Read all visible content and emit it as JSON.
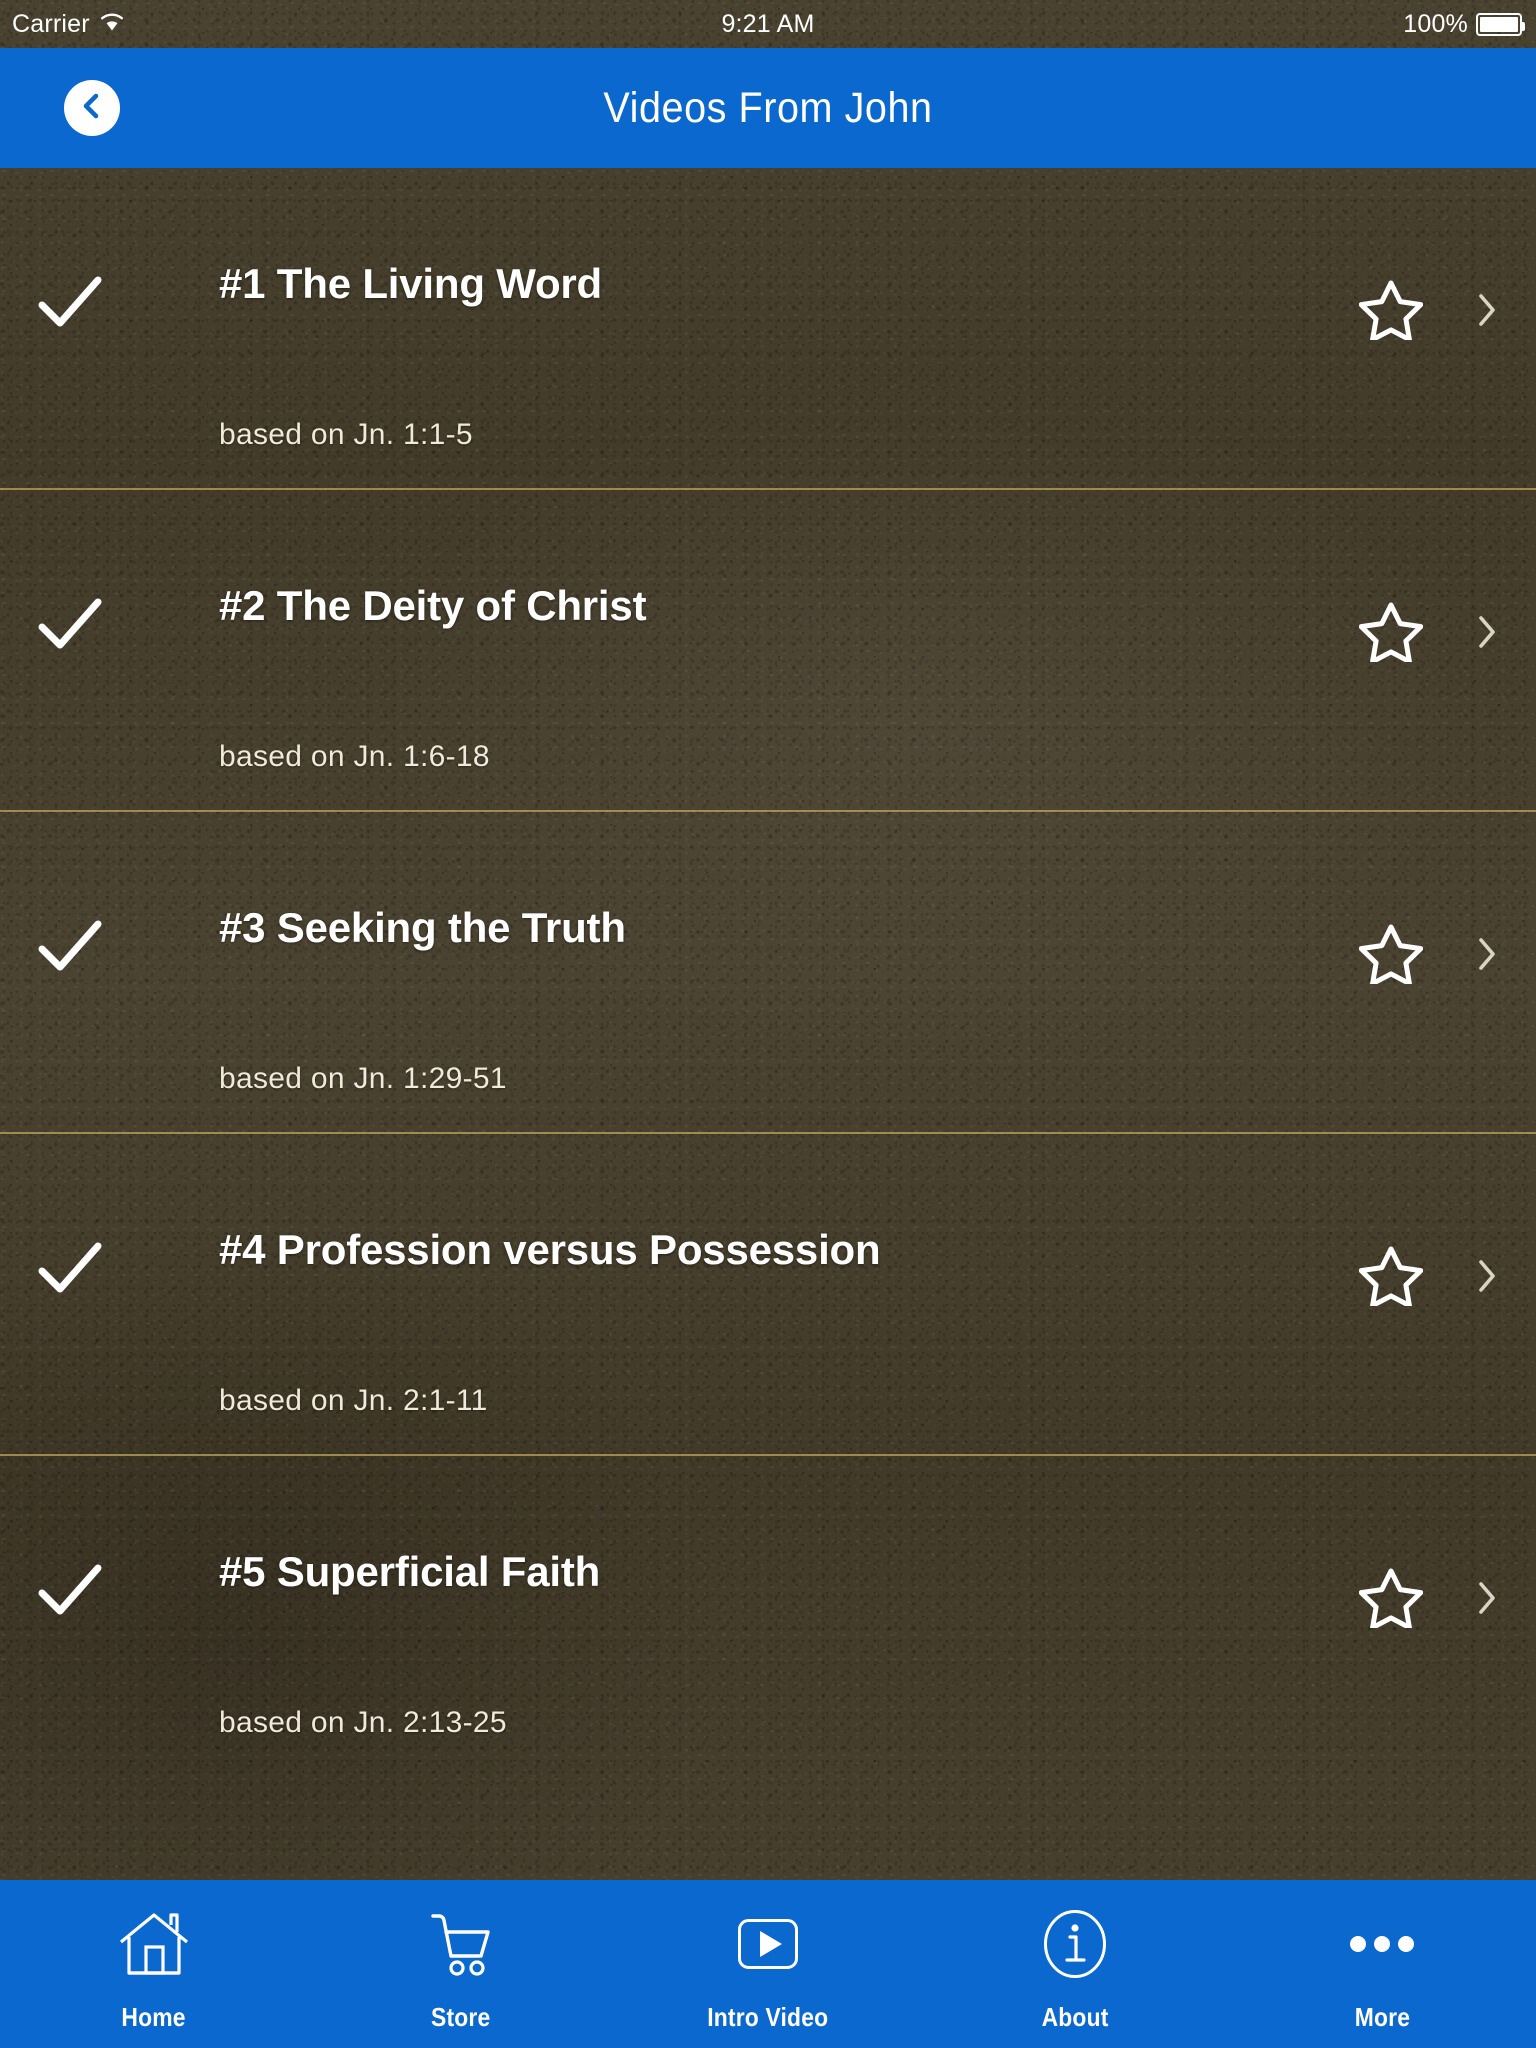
{
  "status_bar": {
    "carrier": "Carrier",
    "wifi_icon": "wifi-icon",
    "time": "9:21 AM",
    "battery_percent": "100%",
    "battery_icon": "battery-full-icon"
  },
  "nav_bar": {
    "title": "Videos From John",
    "back_icon": "chevron-left-icon",
    "background_color": "#0a68ce"
  },
  "colors": {
    "accent_blue": "#0a68ce",
    "leather_brown": "#443c29",
    "divider_gold": "#bea55a",
    "text_white": "#ffffff"
  },
  "list": {
    "rows": [
      {
        "title": "#1 The Living Word",
        "subtitle": "based on Jn. 1:1-5",
        "check_icon": "checkmark-icon",
        "star_icon": "star-outline-icon",
        "chevron_icon": "chevron-right-icon"
      },
      {
        "title": "#2 The Deity of Christ",
        "subtitle": "based on Jn. 1:6-18",
        "check_icon": "checkmark-icon",
        "star_icon": "star-outline-icon",
        "chevron_icon": "chevron-right-icon"
      },
      {
        "title": "#3 Seeking the Truth",
        "subtitle": "based on Jn. 1:29-51",
        "check_icon": "checkmark-icon",
        "star_icon": "star-outline-icon",
        "chevron_icon": "chevron-right-icon"
      },
      {
        "title": "#4 Profession versus Possession",
        "subtitle": "based on Jn. 2:1-11",
        "check_icon": "checkmark-icon",
        "star_icon": "star-outline-icon",
        "chevron_icon": "chevron-right-icon"
      },
      {
        "title": "#5 Superficial Faith",
        "subtitle": "based on Jn. 2:13-25",
        "check_icon": "checkmark-icon",
        "star_icon": "star-outline-icon",
        "chevron_icon": "chevron-right-icon"
      }
    ]
  },
  "tab_bar": {
    "tabs": [
      {
        "label": "Home",
        "icon": "home-icon"
      },
      {
        "label": "Store",
        "icon": "shopping-cart-icon"
      },
      {
        "label": "Intro Video",
        "icon": "play-video-icon"
      },
      {
        "label": "About",
        "icon": "info-circle-icon"
      },
      {
        "label": "More",
        "icon": "ellipsis-icon"
      }
    ]
  }
}
